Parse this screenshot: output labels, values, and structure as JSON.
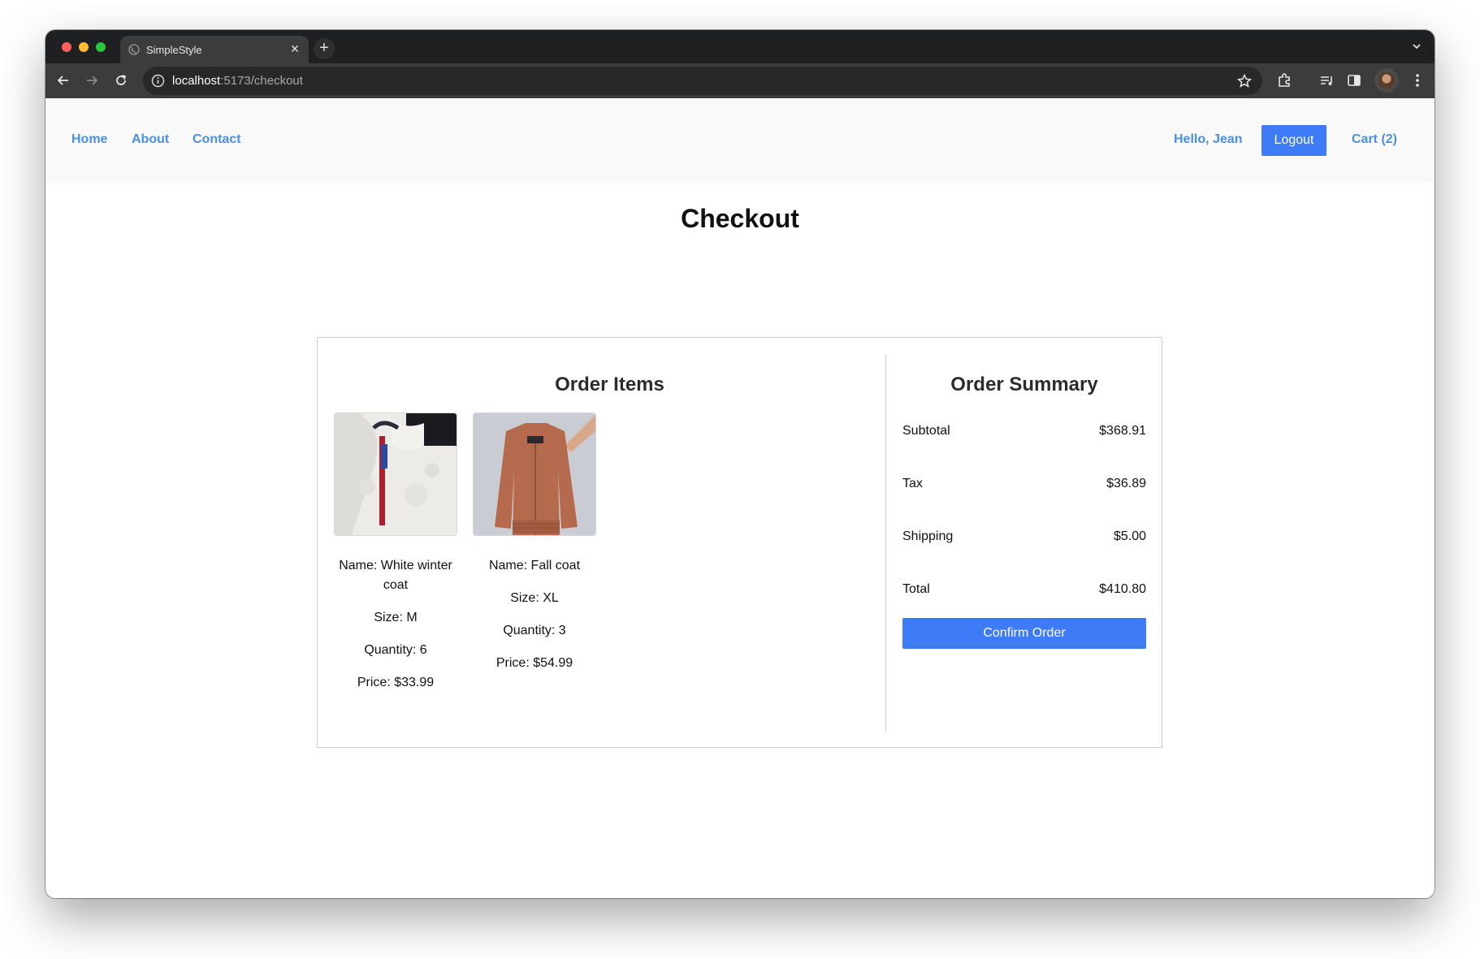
{
  "browser": {
    "tab_title": "SimpleStyle",
    "url_host": "localhost",
    "url_path": ":5173/checkout"
  },
  "nav": {
    "home": "Home",
    "about": "About",
    "contact": "Contact",
    "greeting": "Hello, Jean",
    "logout": "Logout",
    "cart": "Cart (2)"
  },
  "page": {
    "title": "Checkout"
  },
  "order_items": {
    "title": "Order Items",
    "items": [
      {
        "name": "Name: White winter coat",
        "size": "Size: M",
        "quantity": "Quantity: 6",
        "price": "Price: $33.99",
        "image": "white-fleece-jacket"
      },
      {
        "name": "Name: Fall coat",
        "size": "Size: XL",
        "quantity": "Quantity: 3",
        "price": "Price: $54.99",
        "image": "brown-bomber-jacket"
      }
    ]
  },
  "summary": {
    "title": "Order Summary",
    "rows": [
      {
        "label": "Subtotal",
        "value": "$368.91"
      },
      {
        "label": "Tax",
        "value": "$36.89"
      },
      {
        "label": "Shipping",
        "value": "$5.00"
      },
      {
        "label": "Total",
        "value": "$410.80"
      }
    ],
    "confirm": "Confirm Order"
  },
  "colors": {
    "accent": "#3e7bf6",
    "link": "#4a90e2",
    "nav_bg": "#f9f9f9"
  }
}
